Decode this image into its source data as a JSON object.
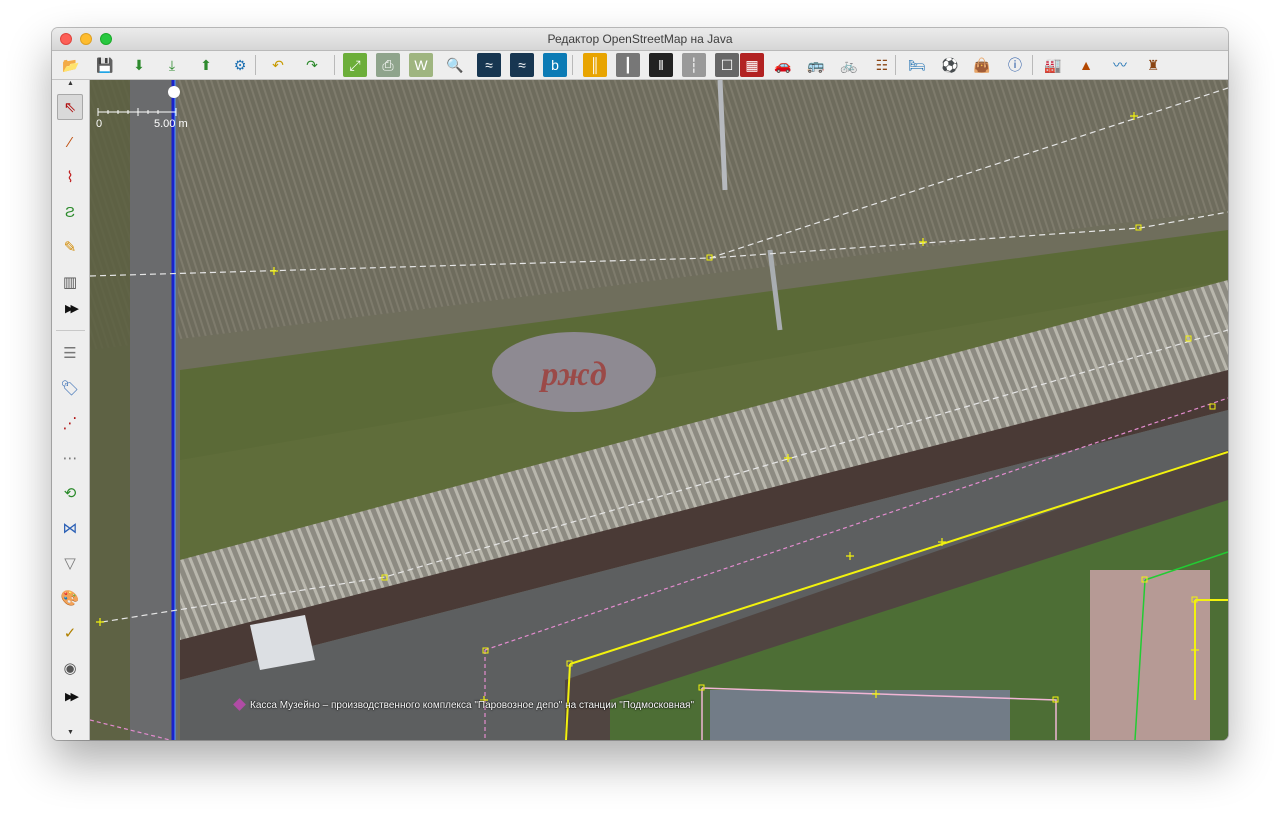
{
  "window": {
    "title": "Редактор OpenStreetMap на Java"
  },
  "toolbar": {
    "buttons": [
      {
        "name": "open-file-icon",
        "glyph": "📂"
      },
      {
        "name": "save-icon",
        "glyph": "💾"
      },
      {
        "name": "download-icon",
        "glyph": "⬇"
      },
      {
        "name": "download-new-layer-icon",
        "glyph": "⤓"
      },
      {
        "name": "upload-icon",
        "glyph": "⬆"
      },
      {
        "name": "preferences-icon",
        "glyph": "⚙"
      },
      {
        "name": "undo-icon",
        "glyph": "↶"
      },
      {
        "name": "redo-icon",
        "glyph": "↷"
      },
      {
        "name": "zoom-to-data-icon",
        "glyph": "⤢"
      },
      {
        "name": "print-icon",
        "glyph": "⎙"
      },
      {
        "name": "wms-tms-icon",
        "glyph": "W"
      },
      {
        "name": "search-icon",
        "glyph": "🔍"
      },
      {
        "name": "imagery-1-icon",
        "glyph": "≈"
      },
      {
        "name": "imagery-2-icon",
        "glyph": "≈"
      },
      {
        "name": "bing-icon",
        "glyph": "b"
      },
      {
        "name": "road-icon",
        "glyph": "║"
      },
      {
        "name": "track-icon",
        "glyph": "┃"
      },
      {
        "name": "railway-track-icon",
        "glyph": "‖"
      },
      {
        "name": "path-icon",
        "glyph": "┆"
      },
      {
        "name": "traffic-light-icon",
        "glyph": "☐"
      },
      {
        "name": "wall-icon",
        "glyph": "▦"
      },
      {
        "name": "car-icon",
        "glyph": "🚗"
      },
      {
        "name": "bus-icon",
        "glyph": "🚌"
      },
      {
        "name": "bicycle-icon",
        "glyph": "🚲"
      },
      {
        "name": "railway-icon",
        "glyph": "☷"
      },
      {
        "name": "bed-icon",
        "glyph": "🛏"
      },
      {
        "name": "sport-icon",
        "glyph": "⚽"
      },
      {
        "name": "shop-icon",
        "glyph": "👜"
      },
      {
        "name": "info-icon",
        "glyph": "ⓘ"
      },
      {
        "name": "industrial-icon",
        "glyph": "🏭"
      },
      {
        "name": "peak-icon",
        "glyph": "▲"
      },
      {
        "name": "water-icon",
        "glyph": "〰"
      },
      {
        "name": "castle-icon",
        "glyph": "♜"
      }
    ]
  },
  "sidebar": {
    "tools": [
      {
        "name": "select-tool-icon",
        "glyph": "⇖",
        "selected": true
      },
      {
        "name": "draw-line-tool-icon",
        "glyph": "⁄"
      },
      {
        "name": "improve-way-tool-icon",
        "glyph": "⌇"
      },
      {
        "name": "parallel-tool-icon",
        "glyph": "Ƨ"
      },
      {
        "name": "pencil-tool-icon",
        "glyph": "✎"
      },
      {
        "name": "building-tool-icon",
        "glyph": "▥"
      }
    ],
    "panels": [
      {
        "name": "layers-panel-icon",
        "glyph": "☰"
      },
      {
        "name": "tags-panel-icon",
        "glyph": "🏷"
      },
      {
        "name": "relations-panel-icon",
        "glyph": "⋰"
      },
      {
        "name": "selection-panel-icon",
        "glyph": "⋯"
      },
      {
        "name": "history-panel-icon",
        "glyph": "⟲"
      },
      {
        "name": "conflict-panel-icon",
        "glyph": "⋈"
      },
      {
        "name": "filter-panel-icon",
        "glyph": "▽"
      },
      {
        "name": "map-paint-styles-icon",
        "glyph": "🎨"
      },
      {
        "name": "validation-panel-icon",
        "glyph": "✓"
      },
      {
        "name": "notes-panel-icon",
        "glyph": "◉"
      }
    ]
  },
  "map": {
    "scale_zero": "0",
    "scale_label": "5.00 m",
    "object_label": "Касса Музейно – производственного комплекса \"Паровозное депо\" на станции \"Подмосковная\""
  }
}
